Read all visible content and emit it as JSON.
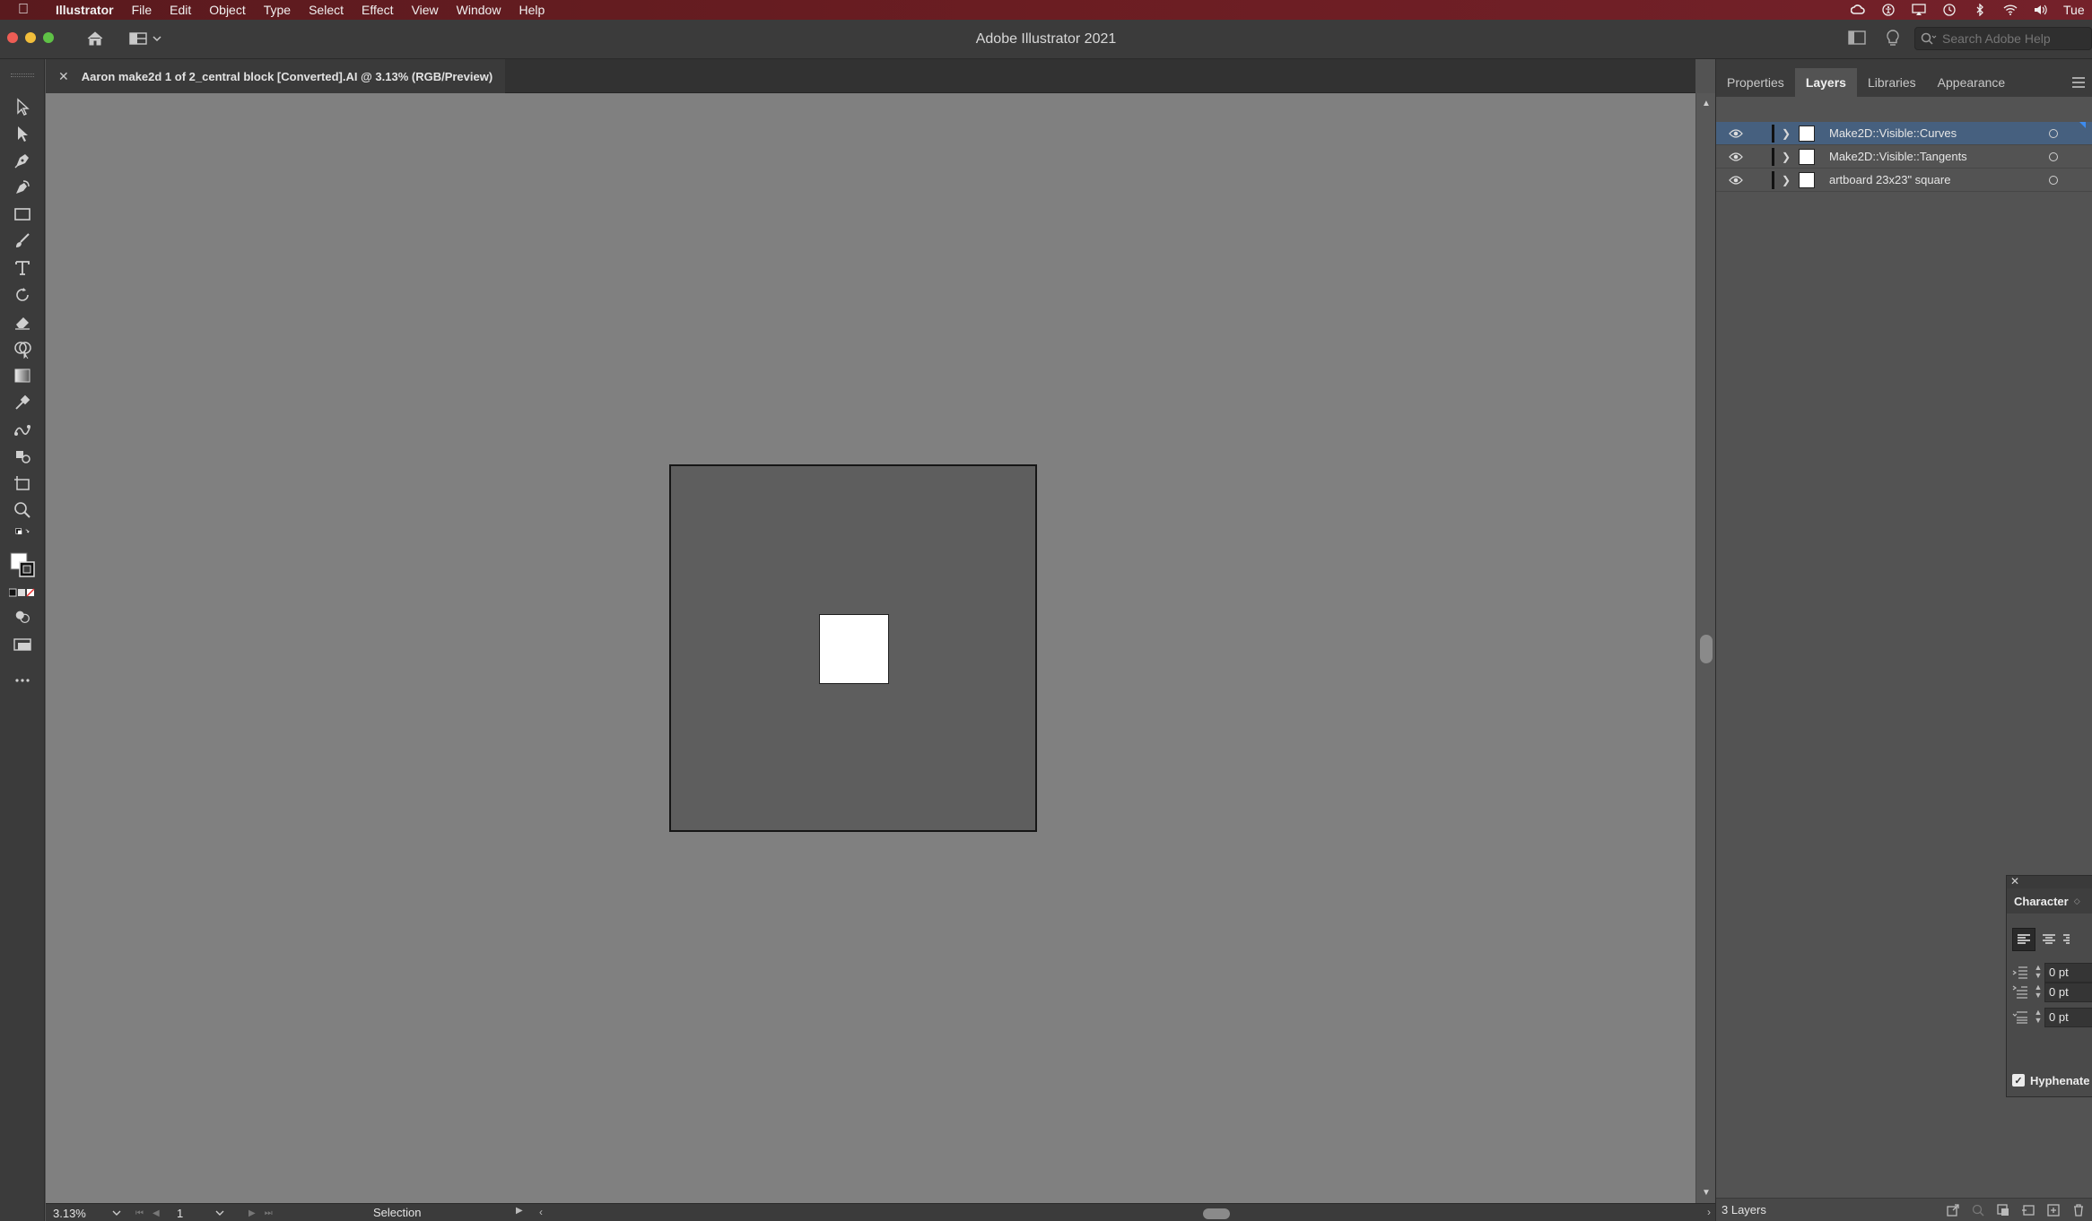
{
  "menubar": {
    "app_name": "Illustrator",
    "items": [
      "File",
      "Edit",
      "Object",
      "Type",
      "Select",
      "Effect",
      "View",
      "Window",
      "Help"
    ],
    "clock": "Tue",
    "status_icons": [
      "creative-cloud-icon",
      "accessibility-icon",
      "airplay-icon",
      "time-machine-icon",
      "bluetooth-icon",
      "wifi-icon",
      "volume-icon"
    ]
  },
  "titlebar": {
    "title": "Adobe Illustrator 2021",
    "search_placeholder": "Search Adobe Help"
  },
  "document": {
    "tab_title": "Aaron make2d 1 of 2_central block [Converted].AI @ 3.13% (RGB/Preview)",
    "close_glyph": "✕"
  },
  "tools": [
    "selection-tool",
    "direct-selection-tool",
    "pen-tool",
    "curvature-tool",
    "rectangle-tool",
    "paintbrush-tool",
    "type-tool",
    "rotate-tool",
    "eraser-tool",
    "shape-builder-tool",
    "gradient-tool",
    "eyedropper-tool",
    "blend-tool",
    "symbol-sprayer-tool",
    "artboard-tool",
    "zoom-tool"
  ],
  "status": {
    "zoom": "3.13%",
    "page": "1",
    "tool_name": "Selection"
  },
  "panel": {
    "tabs": [
      "Properties",
      "Layers",
      "Libraries",
      "Appearance"
    ],
    "active_tab": "Layers",
    "layers": [
      {
        "name": "Make2D::Visible::Curves",
        "selected": true
      },
      {
        "name": "Make2D::Visible::Tangents",
        "selected": false
      },
      {
        "name": "artboard 23x23\" square",
        "selected": false
      }
    ],
    "layer_count": "3 Layers"
  },
  "character": {
    "title": "Character",
    "indent_left": "0 pt",
    "indent_first": "0 pt",
    "space_before": "0 pt",
    "hyphenate_label": "Hyphenate",
    "hyphenate_checked": true
  },
  "colors": {
    "canvas": "#808080",
    "artboard": "#5e5e5e",
    "selection_highlight": "#46607f",
    "menubar": "#6b1d22"
  }
}
